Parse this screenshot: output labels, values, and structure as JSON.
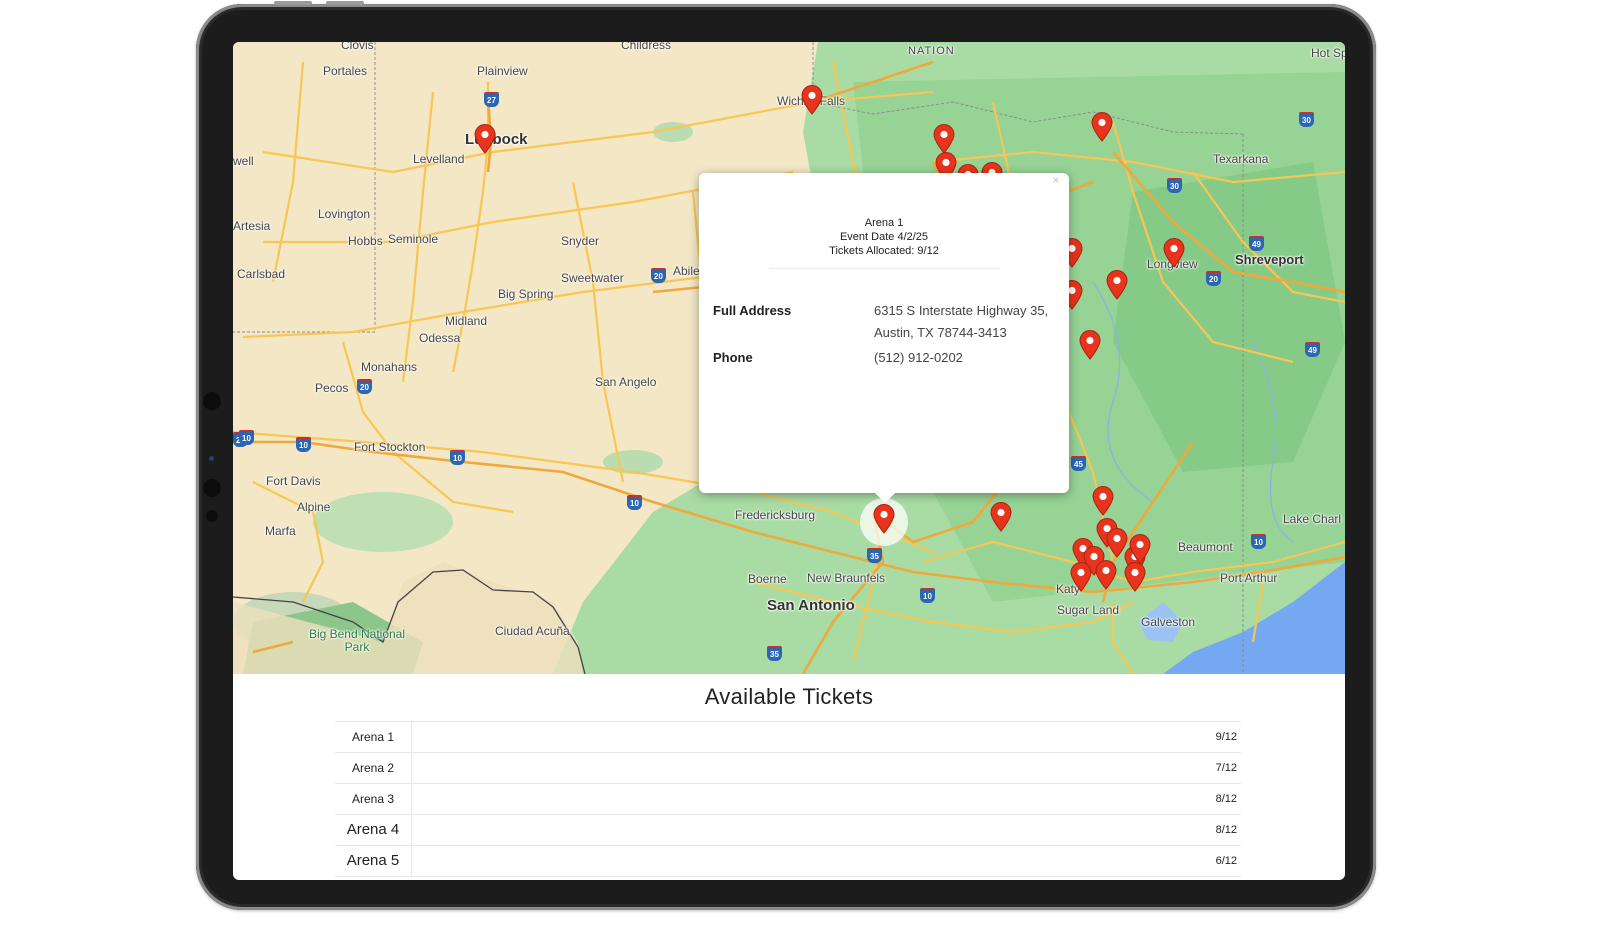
{
  "map": {
    "places": [
      {
        "label": "Clovis",
        "style": ""
      },
      {
        "label": "Portales",
        "style": ""
      },
      {
        "label": "Plainview",
        "style": ""
      },
      {
        "label": "Childress",
        "style": ""
      },
      {
        "label": "NATION",
        "style": ""
      },
      {
        "label": "Hot Sp",
        "style": ""
      },
      {
        "label": "Wichita Falls",
        "style": ""
      },
      {
        "label": "Lubbock",
        "style": ""
      },
      {
        "label": "Levelland",
        "style": ""
      },
      {
        "label": "Texarkana",
        "style": ""
      },
      {
        "label": "well",
        "style": ""
      },
      {
        "label": "Lovington",
        "style": ""
      },
      {
        "label": "Artesia",
        "style": ""
      },
      {
        "label": "Hobbs",
        "style": ""
      },
      {
        "label": "Seminole",
        "style": ""
      },
      {
        "label": "Snyder",
        "style": ""
      },
      {
        "label": "Longview",
        "style": ""
      },
      {
        "label": "Shreveport",
        "style": "big"
      },
      {
        "label": "Carlsbad",
        "style": ""
      },
      {
        "label": "Sweetwater",
        "style": ""
      },
      {
        "label": "Abilene",
        "style": ""
      },
      {
        "label": "Big Spring",
        "style": ""
      },
      {
        "label": "Midland",
        "style": ""
      },
      {
        "label": "Odessa",
        "style": ""
      },
      {
        "label": "Monahans",
        "style": ""
      },
      {
        "label": "Pecos",
        "style": ""
      },
      {
        "label": "San Angelo",
        "style": ""
      },
      {
        "label": "Fort Stockton",
        "style": ""
      },
      {
        "label": "Fort Davis",
        "style": ""
      },
      {
        "label": "Alpine",
        "style": ""
      },
      {
        "label": "Marfa",
        "style": ""
      },
      {
        "label": "Fredericksburg",
        "style": ""
      },
      {
        "label": "Boerne",
        "style": ""
      },
      {
        "label": "New Braunfels",
        "style": ""
      },
      {
        "label": "San Antonio",
        "style": "big"
      },
      {
        "label": "Ciudad Acuña",
        "style": ""
      },
      {
        "label": "Big Bend National Park",
        "style": "park"
      },
      {
        "label": "Katy",
        "style": ""
      },
      {
        "label": "Sugar Land",
        "style": ""
      },
      {
        "label": "Galveston",
        "style": ""
      },
      {
        "label": "Beaumont",
        "style": ""
      },
      {
        "label": "Port Arthur",
        "style": ""
      },
      {
        "label": "Lake Charl",
        "style": ""
      }
    ],
    "shields": [
      "27",
      "30",
      "30",
      "20",
      "49",
      "20",
      "20",
      "49",
      "20",
      "10",
      "10",
      "10",
      "45",
      "10",
      "35",
      "10",
      "35",
      "10"
    ],
    "pin_color": "#e8341c",
    "pin_icon": "map-marker-icon"
  },
  "popup": {
    "title": "Arena 1",
    "event_date": "Event Date 4/2/25",
    "tickets_allocated": "Tickets Allocated: 9/12",
    "close": "×",
    "address_label": "Full Address",
    "address_line1": "6315 S Interstate Highway 35,",
    "address_line2": "Austin, TX 78744-3413",
    "phone_label": "Phone",
    "phone_value": "(512) 912-0202"
  },
  "list": {
    "title": "Available Tickets",
    "rows": [
      {
        "name": "Arena 1",
        "qty": "9/12"
      },
      {
        "name": "Arena 2",
        "qty": "7/12"
      },
      {
        "name": "Arena 3",
        "qty": "8/12"
      },
      {
        "name": "Arena 4",
        "qty": "8/12"
      },
      {
        "name": "Arena 5",
        "qty": "6/12"
      }
    ]
  }
}
